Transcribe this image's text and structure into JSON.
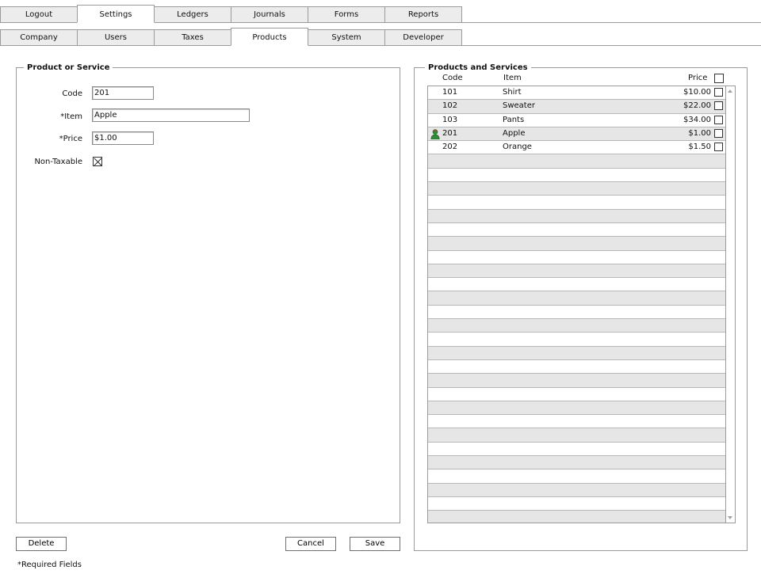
{
  "tabs_top": [
    {
      "label": "Logout",
      "active": false
    },
    {
      "label": "Settings",
      "active": true
    },
    {
      "label": "Ledgers",
      "active": false
    },
    {
      "label": "Journals",
      "active": false
    },
    {
      "label": "Forms",
      "active": false
    },
    {
      "label": "Reports",
      "active": false
    }
  ],
  "tabs_sub": [
    {
      "label": "Company",
      "active": false
    },
    {
      "label": "Users",
      "active": false
    },
    {
      "label": "Taxes",
      "active": false
    },
    {
      "label": "Products",
      "active": true
    },
    {
      "label": "System",
      "active": false
    },
    {
      "label": "Developer",
      "active": false
    }
  ],
  "form": {
    "legend": "Product or Service",
    "code_label": "Code",
    "code_value": "201",
    "item_label": "*Item",
    "item_value": "Apple",
    "price_label": "*Price",
    "price_value": "$1.00",
    "nontaxable_label": "Non-Taxable",
    "nontaxable_checked": true
  },
  "buttons": {
    "delete": "Delete",
    "cancel": "Cancel",
    "save": "Save"
  },
  "footer_note": "*Required Fields",
  "list": {
    "legend": "Products and Services",
    "columns": {
      "code": "Code",
      "item": "Item",
      "price": "Price"
    },
    "rows": [
      {
        "code": "101",
        "item": "Shirt",
        "price": "$10.00",
        "selected": false
      },
      {
        "code": "102",
        "item": "Sweater",
        "price": "$22.00",
        "selected": false
      },
      {
        "code": "103",
        "item": "Pants",
        "price": "$34.00",
        "selected": false
      },
      {
        "code": "201",
        "item": "Apple",
        "price": "$1.00",
        "selected": true,
        "icon": "user-icon"
      },
      {
        "code": "202",
        "item": "Orange",
        "price": "$1.50",
        "selected": false
      }
    ]
  },
  "colors": {
    "border": "#9a9a9a",
    "tab_inactive": "#ececec",
    "row_alt": "#e6e6e6",
    "user_icon": "#2e8b3a"
  }
}
